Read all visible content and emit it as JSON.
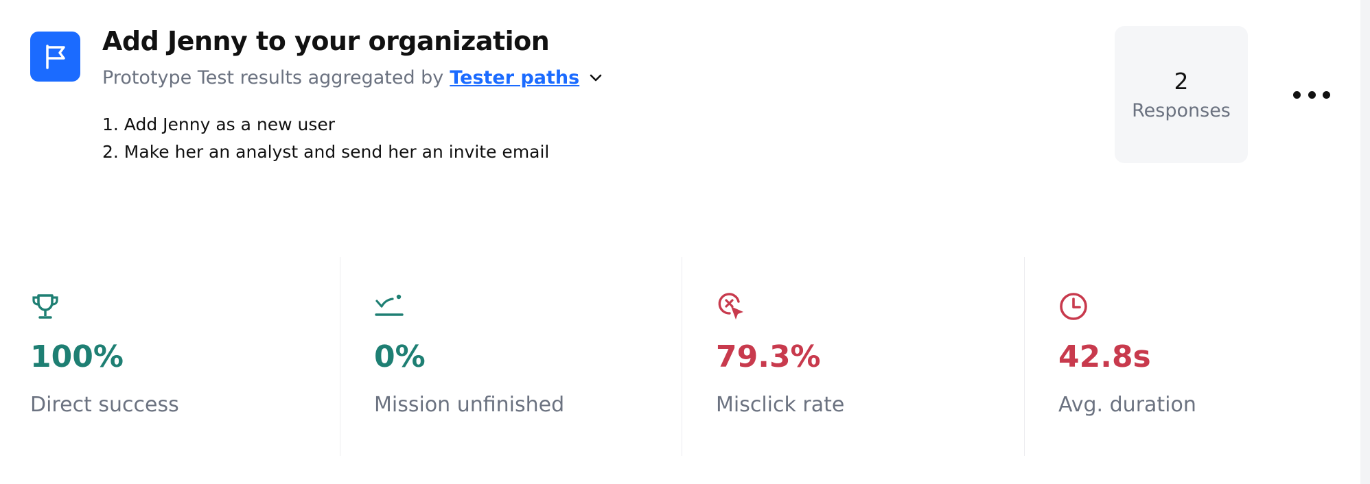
{
  "header": {
    "icon": "flag-icon",
    "title": "Add Jenny to your organization",
    "subtitle_prefix": "Prototype Test results aggregated by",
    "aggregation_link": "Tester paths",
    "tasks": [
      "1. Add Jenny as a new user",
      "2. Make her an analyst and send her an invite email"
    ]
  },
  "responses": {
    "count": "2",
    "label": "Responses"
  },
  "more_menu": {
    "icon": "more-horizontal-icon"
  },
  "stats": [
    {
      "icon": "trophy-icon",
      "value": "100%",
      "label": "Direct success",
      "color": "#1e7f73"
    },
    {
      "icon": "mission-unfinished-icon",
      "value": "0%",
      "label": "Mission unfinished",
      "color": "#1e7f73"
    },
    {
      "icon": "misclick-icon",
      "value": "79.3%",
      "label": "Misclick rate",
      "color": "#c83a4d"
    },
    {
      "icon": "clock-icon",
      "value": "42.8s",
      "label": "Avg. duration",
      "color": "#c83a4d"
    }
  ],
  "colors": {
    "accent": "#1b6bff",
    "success": "#1e7f73",
    "danger": "#c83a4d",
    "muted": "#6b7280"
  }
}
